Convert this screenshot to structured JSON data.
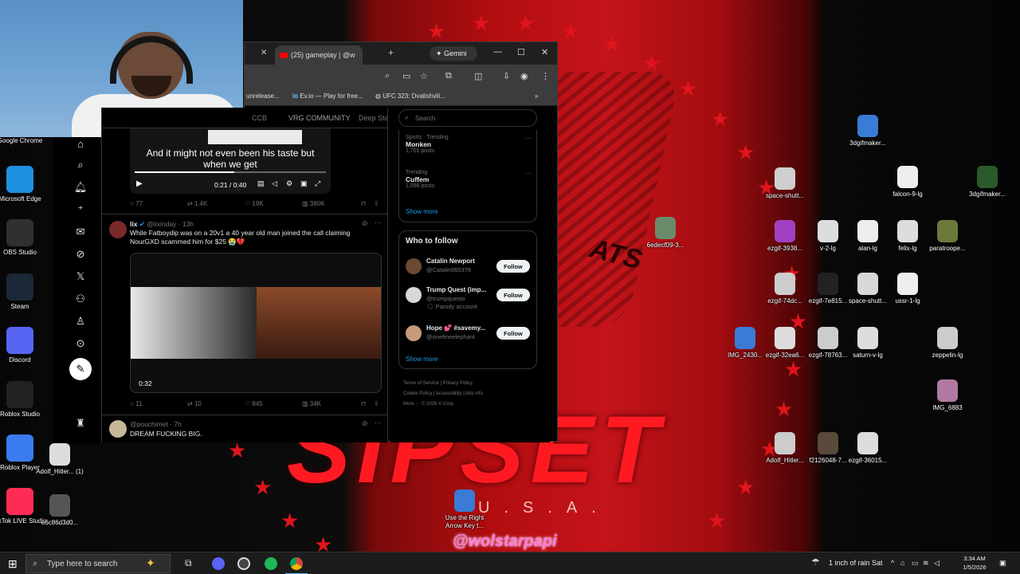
{
  "browser": {
    "tab_title": "(25) gameplay | @w",
    "gemini_label": "Gemini",
    "bookmarks": [
      "unrelease...",
      "Ev.io — Play for free...",
      "UFC 323: Dvalishvili..."
    ]
  },
  "video_caption": "And it might not even been his taste but when we get",
  "video_time": "0:21 / 0:40",
  "feed_tabs": [
    "CCB",
    "VRG COMMUNITY",
    "Deep Sta"
  ],
  "posts": [
    {
      "actions": [
        "77",
        "1.4K",
        "19K",
        "380K"
      ]
    },
    {
      "name": "lix",
      "handle": "@lixinday · 13h",
      "text1": "While Fatboydip was on a 20v1 a 40 year old man joined the call claiming",
      "text2": "NourGXD scammed him for $25 😭💔",
      "video_time": "0:32",
      "actions": [
        "11",
        "10",
        "845",
        "34K"
      ]
    },
    {
      "handle": "@pouchimet · 7h",
      "text": "DREAM FUCKING BIG."
    }
  ],
  "right": {
    "search_placeholder": "Search",
    "trends": [
      {
        "category": "Sports · Trending",
        "name": "Monken",
        "count": "1,701 posts"
      },
      {
        "category": "Trending",
        "name": "Cuffem",
        "count": "1,098 posts"
      }
    ],
    "show_more": "Show more",
    "who_to_follow": "Who to follow",
    "suggestions": [
      {
        "name": "Catalin Newport",
        "handle": "@Catalin065378",
        "extra": ""
      },
      {
        "name": "Trump Quest (imp...",
        "handle": "@trumpquestx",
        "extra": "🗨 Parody account"
      },
      {
        "name": "Hope 💕 #savemy...",
        "handle": "@onefineelephant",
        "extra": ""
      }
    ],
    "follow_label": "Follow",
    "footer": [
      "Terms of Service",
      "Privacy Policy",
      "Cookie Policy",
      "Accessibility",
      "Ads info",
      "More ···",
      "© 2026 X Corp."
    ]
  },
  "desktop_icons_left": [
    {
      "label": "Google Chrome",
      "icon": "chrome-icon",
      "color": "#dddddd"
    },
    {
      "label": "Microsoft Edge",
      "icon": "edge-icon",
      "color": "#1f8fe0"
    },
    {
      "label": "OBS Studio",
      "icon": "obs-icon",
      "color": "#303030"
    },
    {
      "label": "Steam",
      "icon": "steam-icon",
      "color": "#1b2838"
    },
    {
      "label": "Discord",
      "icon": "discord-icon",
      "color": "#5865f2"
    },
    {
      "label": "Roblox Studio",
      "icon": "roblox-studio-icon",
      "color": "#222222"
    },
    {
      "label": "Roblox Player",
      "icon": "roblox-player-icon",
      "color": "#3a7bf0"
    },
    {
      "label": "TikTok LIVE Studio",
      "icon": "tiktok-icon",
      "color": "#fe2c55"
    }
  ],
  "desktop_icons_other": [
    {
      "label": "Adolf_Hitler... (1)"
    },
    {
      "label": "e6c86d3d0..."
    },
    {
      "label": "6edecf09-3..."
    },
    {
      "label": "Use the Right Arrow Key t..."
    },
    {
      "label": "3dgifmaker..."
    },
    {
      "label": "space-shutt..."
    },
    {
      "label": "falcon-9-lg"
    },
    {
      "label": "3dgifmaker..."
    },
    {
      "label": "ezgif-3938..."
    },
    {
      "label": "v-2-lg"
    },
    {
      "label": "alan-lg"
    },
    {
      "label": "felix-lg"
    },
    {
      "label": "paratroope..."
    },
    {
      "label": "ezgif-74dc..."
    },
    {
      "label": "ezgif-7e815..."
    },
    {
      "label": "space-shutt..."
    },
    {
      "label": "ussr-1-lg"
    },
    {
      "label": "IMG_2430..."
    },
    {
      "label": "ezgif-32ea6..."
    },
    {
      "label": "ezgif-78763..."
    },
    {
      "label": "saturn-v-lg"
    },
    {
      "label": "zeppelin-lg"
    },
    {
      "label": "IMG_6883"
    },
    {
      "label": "Adolf_Hitler..."
    },
    {
      "label": "f2126048-7..."
    },
    {
      "label": "ezgif-36015..."
    }
  ],
  "wallpaper": {
    "watermark": "@wolstarpapi",
    "big_text": "SIPSET",
    "usa": "U.S.A.",
    "ats": "ATS"
  },
  "taskbar": {
    "search_placeholder": "Type here to search",
    "weather": "1 inch of rain Sat",
    "time": "3:34 AM",
    "date": "1/5/2026"
  }
}
